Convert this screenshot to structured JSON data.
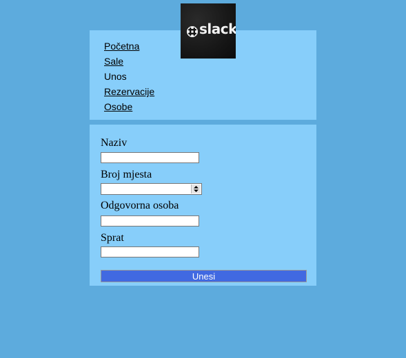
{
  "nav": {
    "items": [
      {
        "label": "Početna",
        "link": true
      },
      {
        "label": "Sale",
        "link": true
      },
      {
        "label": "Unos",
        "link": false
      },
      {
        "label": "Rezervacije",
        "link": true
      },
      {
        "label": "Osobe",
        "link": true
      }
    ]
  },
  "logo": {
    "text": "slack"
  },
  "form": {
    "fields": [
      {
        "label": "Naziv",
        "value": ""
      },
      {
        "label": "Broj mjesta",
        "value": ""
      },
      {
        "label": "Odgovorna osoba",
        "value": ""
      },
      {
        "label": "Sprat",
        "value": ""
      }
    ],
    "submit_label": "Unesi"
  },
  "colors": {
    "page_background": "#5dabdd",
    "panel_background": "#87cefa",
    "button_background": "#4169e1"
  }
}
